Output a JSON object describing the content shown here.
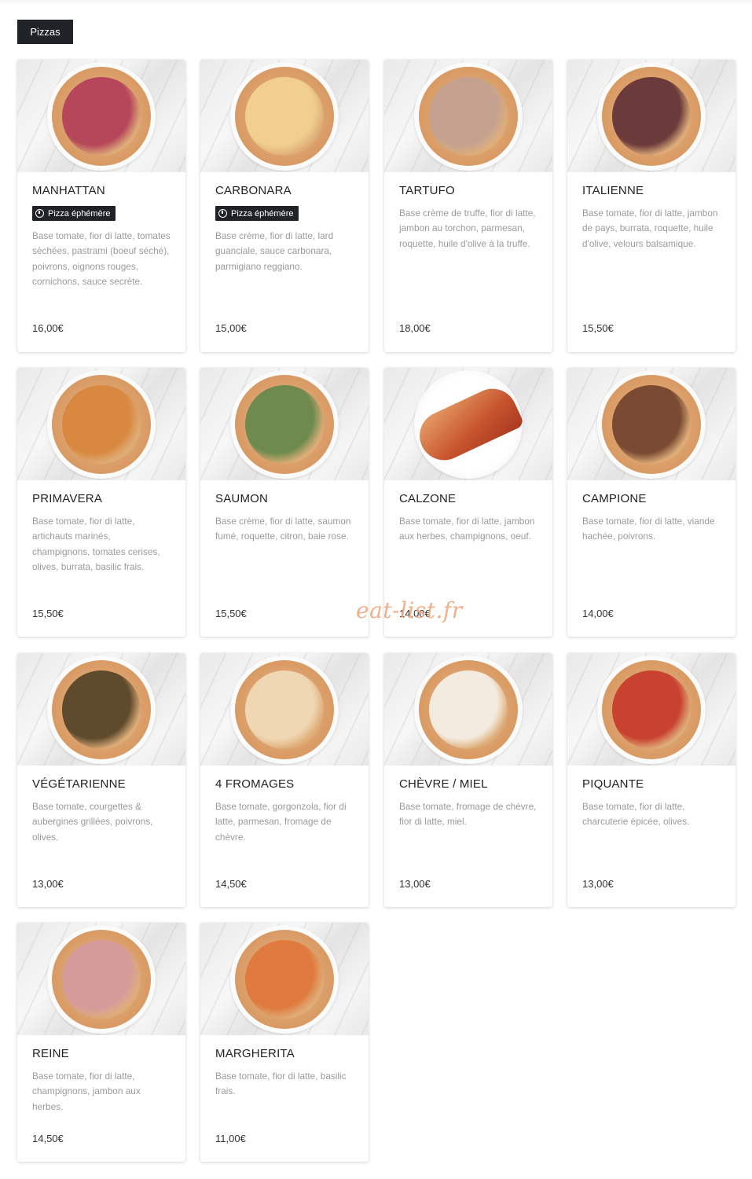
{
  "tab": {
    "label": "Pizzas"
  },
  "watermark": "eat-list.fr",
  "badge_label": "Pizza éphémère",
  "colors": {
    "tab_bg": "#1f2328",
    "desc_text": "#9a9a9a",
    "watermark": "#f0a77f"
  },
  "items": [
    {
      "name": "MANHATTAN",
      "ephemeral": true,
      "description": "Base tomate, fior di latte, tomates séchées, pastrami (boeuf séché), poivrons, oignons rouges, cornichons, sauce secrète.",
      "price": "16,00€",
      "topping_color": "#b6475a"
    },
    {
      "name": "CARBONARA",
      "ephemeral": true,
      "description": "Base crème, fior di latte, lard guanciale, sauce carbonara, parmigiano reggiano.",
      "price": "15,00€",
      "topping_color": "#f1cf8e"
    },
    {
      "name": "TARTUFO",
      "ephemeral": false,
      "description": "Base crème de truffe, fior di latte, jambon au torchon, parmesan, roquette, huile d'olive à la truffe.",
      "price": "18,00€",
      "topping_color": "#c4a28f"
    },
    {
      "name": "ITALIENNE",
      "ephemeral": false,
      "description": "Base tomate, fior di latte, jambon de pays, burrata, roquette, huile d'olive, velours balsamique.",
      "price": "15,50€",
      "topping_color": "#6b3a3a"
    },
    {
      "name": "PRIMAVERA",
      "ephemeral": false,
      "description": "Base tomate, fior di latte, artichauts marinés, champignons, tomates cerises, olives, burrata, basilic frais.",
      "price": "15,50€",
      "topping_color": "#d8893f"
    },
    {
      "name": "SAUMON",
      "ephemeral": false,
      "description": "Base crème, fior di latte, saumon fumé, roquette, citron, baie rose.",
      "price": "15,50€",
      "topping_color": "#6f8a4e"
    },
    {
      "name": "CALZONE",
      "ephemeral": false,
      "description": "Base tomate, fior di latte, jambon aux herbes, champignons, oeuf.",
      "price": "14,00€",
      "topping_color": "#c7542e"
    },
    {
      "name": "CAMPIONE",
      "ephemeral": false,
      "description": "Base tomate, fior di latte, viande hachée, poivrons.",
      "price": "14,00€",
      "topping_color": "#7a4a32"
    },
    {
      "name": "VÉGÉTARIENNE",
      "ephemeral": false,
      "description": "Base tomate, courgettes & aubergines grillées, poivrons, olives.",
      "price": "13,00€",
      "topping_color": "#5e4a2c"
    },
    {
      "name": "4 FROMAGES",
      "ephemeral": false,
      "description": "Base tomate, gorgonzola, fior di latte, parmesan, fromage de chèvre.",
      "price": "14,50€",
      "topping_color": "#f0d7b4"
    },
    {
      "name": "CHÈVRE / MIEL",
      "ephemeral": false,
      "description": "Base tomate, fromage de chèvre, fior di latte, miel.",
      "price": "13,00€",
      "topping_color": "#f3ebe0"
    },
    {
      "name": "PIQUANTE",
      "ephemeral": false,
      "description": "Base tomate, fior di latte, charcuterie épicée, olives.",
      "price": "13,00€",
      "topping_color": "#c9412f"
    },
    {
      "name": "REINE",
      "ephemeral": false,
      "description": "Base tomate, fior di latte, champignons, jambon aux herbes.",
      "price": "14,50€",
      "topping_color": "#d59a9a"
    },
    {
      "name": "MARGHERITA",
      "ephemeral": false,
      "description": "Base tomate, fior di latte, basilic frais.",
      "price": "11,00€",
      "topping_color": "#e07a3e"
    }
  ]
}
